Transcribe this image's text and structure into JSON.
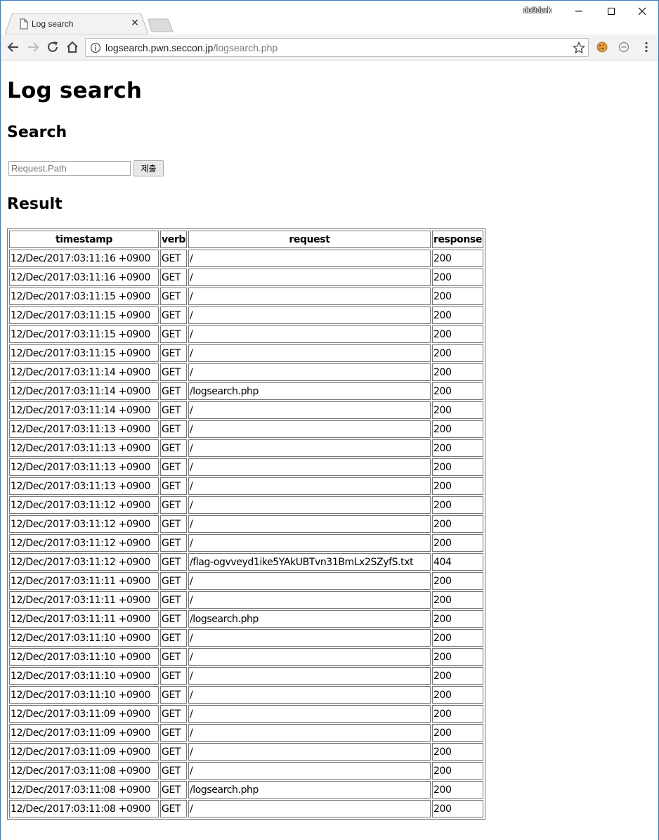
{
  "browser": {
    "tab_title": "Log search",
    "profile_name": "do9dark",
    "url_host": "logsearch.pwn.seccon.jp",
    "url_path": "/logsearch.php"
  },
  "page": {
    "title": "Log search",
    "search_heading": "Search",
    "search_placeholder": "Request.Path",
    "submit_label": "제출",
    "result_heading": "Result"
  },
  "table": {
    "headers": [
      "timestamp",
      "verb",
      "request",
      "response"
    ],
    "rows": [
      [
        "12/Dec/2017:03:11:16 +0900",
        "GET",
        "/",
        "200"
      ],
      [
        "12/Dec/2017:03:11:16 +0900",
        "GET",
        "/",
        "200"
      ],
      [
        "12/Dec/2017:03:11:15 +0900",
        "GET",
        "/",
        "200"
      ],
      [
        "12/Dec/2017:03:11:15 +0900",
        "GET",
        "/",
        "200"
      ],
      [
        "12/Dec/2017:03:11:15 +0900",
        "GET",
        "/",
        "200"
      ],
      [
        "12/Dec/2017:03:11:15 +0900",
        "GET",
        "/",
        "200"
      ],
      [
        "12/Dec/2017:03:11:14 +0900",
        "GET",
        "/",
        "200"
      ],
      [
        "12/Dec/2017:03:11:14 +0900",
        "GET",
        "/logsearch.php",
        "200"
      ],
      [
        "12/Dec/2017:03:11:14 +0900",
        "GET",
        "/",
        "200"
      ],
      [
        "12/Dec/2017:03:11:13 +0900",
        "GET",
        "/",
        "200"
      ],
      [
        "12/Dec/2017:03:11:13 +0900",
        "GET",
        "/",
        "200"
      ],
      [
        "12/Dec/2017:03:11:13 +0900",
        "GET",
        "/",
        "200"
      ],
      [
        "12/Dec/2017:03:11:13 +0900",
        "GET",
        "/",
        "200"
      ],
      [
        "12/Dec/2017:03:11:12 +0900",
        "GET",
        "/",
        "200"
      ],
      [
        "12/Dec/2017:03:11:12 +0900",
        "GET",
        "/",
        "200"
      ],
      [
        "12/Dec/2017:03:11:12 +0900",
        "GET",
        "/",
        "200"
      ],
      [
        "12/Dec/2017:03:11:12 +0900",
        "GET",
        "/flag-ogvveyd1ike5YAkUBTvn31BmLx2SZyfS.txt",
        "404"
      ],
      [
        "12/Dec/2017:03:11:11 +0900",
        "GET",
        "/",
        "200"
      ],
      [
        "12/Dec/2017:03:11:11 +0900",
        "GET",
        "/",
        "200"
      ],
      [
        "12/Dec/2017:03:11:11 +0900",
        "GET",
        "/logsearch.php",
        "200"
      ],
      [
        "12/Dec/2017:03:11:10 +0900",
        "GET",
        "/",
        "200"
      ],
      [
        "12/Dec/2017:03:11:10 +0900",
        "GET",
        "/",
        "200"
      ],
      [
        "12/Dec/2017:03:11:10 +0900",
        "GET",
        "/",
        "200"
      ],
      [
        "12/Dec/2017:03:11:10 +0900",
        "GET",
        "/",
        "200"
      ],
      [
        "12/Dec/2017:03:11:09 +0900",
        "GET",
        "/",
        "200"
      ],
      [
        "12/Dec/2017:03:11:09 +0900",
        "GET",
        "/",
        "200"
      ],
      [
        "12/Dec/2017:03:11:09 +0900",
        "GET",
        "/",
        "200"
      ],
      [
        "12/Dec/2017:03:11:08 +0900",
        "GET",
        "/",
        "200"
      ],
      [
        "12/Dec/2017:03:11:08 +0900",
        "GET",
        "/logsearch.php",
        "200"
      ],
      [
        "12/Dec/2017:03:11:08 +0900",
        "GET",
        "/",
        "200"
      ]
    ]
  },
  "colors": {
    "window_border": "#3c78c8",
    "toolbar_bg": "#f2f2f2",
    "table_border": "#777777"
  },
  "icons": {
    "tab": "document-icon",
    "tab_close": "close-icon",
    "back": "back-arrow-icon",
    "forward": "forward-arrow-icon",
    "reload": "reload-icon",
    "home": "home-icon",
    "site_info": "info-icon",
    "bookmark": "star-icon",
    "extension_1": "cookie-icon",
    "extension_2": "blocked-icon",
    "menu": "kebab-menu-icon"
  }
}
